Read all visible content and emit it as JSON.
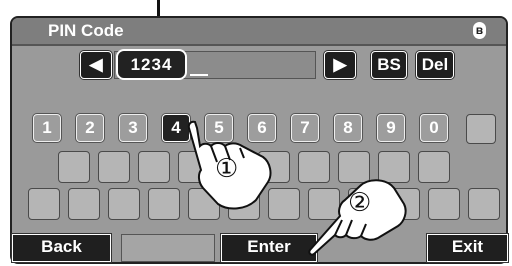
{
  "header": {
    "title": "PIN Code",
    "bluetooth_icon": "bluetooth-icon"
  },
  "pin_entry": {
    "value": "1234"
  },
  "nav_keys": {
    "bs": "BS",
    "del": "Del"
  },
  "number_keys": [
    "1",
    "2",
    "3",
    "4",
    "5",
    "6",
    "7",
    "8",
    "9",
    "0"
  ],
  "active_key": "4",
  "bottom_bar": {
    "back": "Back",
    "enter": "Enter",
    "exit": "Exit"
  },
  "callouts": {
    "step1": "①",
    "step2": "②"
  }
}
